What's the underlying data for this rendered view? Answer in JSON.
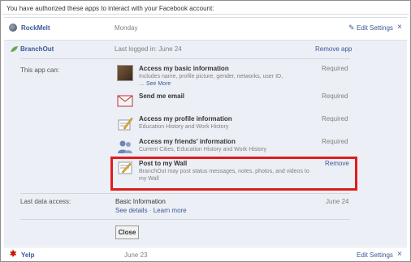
{
  "header": {
    "text": "You have authorized these apps to interact with your Facebook account:"
  },
  "apps": {
    "rockmelt": {
      "name": "RockMelt",
      "date": "Monday",
      "edit_label": "Edit Settings",
      "close_glyph": "×"
    },
    "branchout": {
      "name": "BranchOut",
      "last_logged": "Last logged in: June 24",
      "remove_label": "Remove app",
      "section_label": "This app can:",
      "permissions": [
        {
          "title": "Access my basic information",
          "desc": "Includes name, profile picture, gender, networks, user ID,",
          "desc2": "…",
          "more": "See More",
          "status": "Required",
          "icon": "user-photo-icon"
        },
        {
          "title": "Send me email",
          "desc": "",
          "status": "Required",
          "icon": "email-icon"
        },
        {
          "title": "Access my profile information",
          "desc": "Education History and Work History",
          "status": "Required",
          "icon": "profile-edit-icon"
        },
        {
          "title": "Access my friends' information",
          "desc": "Current Cities, Education History and Work History",
          "status": "Required",
          "icon": "friends-icon"
        },
        {
          "title": "Post to my Wall",
          "desc": "BranchOut may post status messages, notes, photos, and videos to my Wall",
          "status": "Remove",
          "icon": "wall-post-icon"
        }
      ],
      "last_access_label": "Last data access:",
      "last_access_value": "Basic Information",
      "last_access_date": "June 24",
      "see_details": "See details",
      "learn_more": "Learn more",
      "close_label": "Close"
    },
    "yelp": {
      "name": "Yelp",
      "date": "June 23",
      "edit_label": "Edit Settings",
      "close_glyph": "×"
    }
  },
  "colors": {
    "link": "#3b5998",
    "highlight": "#e21b1b",
    "panel": "#eceff5"
  }
}
